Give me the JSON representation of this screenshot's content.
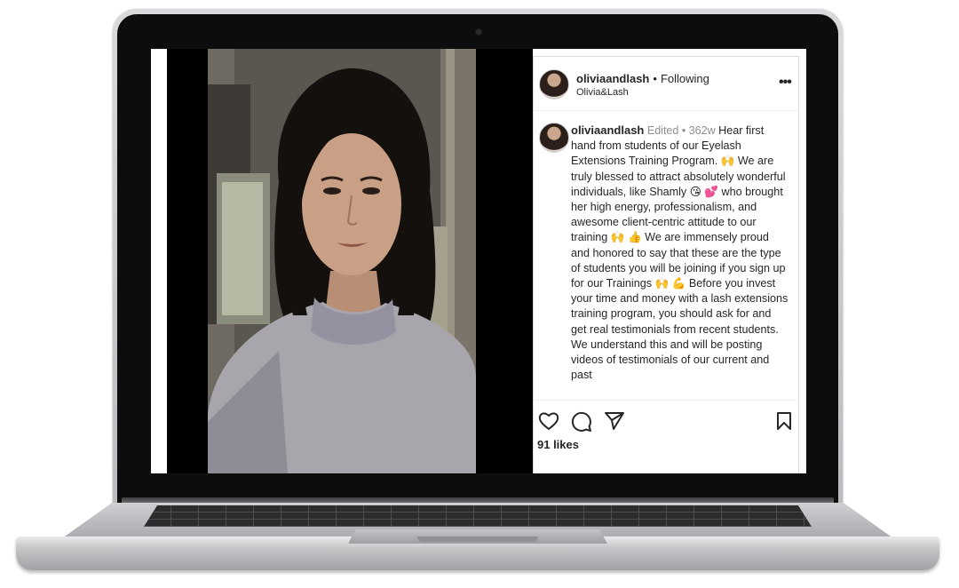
{
  "post": {
    "username": "oliviaandlash",
    "separator": "•",
    "follow_status": "Following",
    "subtitle": "Olivia&Lash",
    "more_label": "•••",
    "caption_username": "oliviaandlash",
    "edited_label": "Edited",
    "age": "362w",
    "caption_text": "Hear first hand from students of our Eyelash Extensions Training Program. 🙌 We are truly blessed to attract absolutely wonderful individuals, like Shamly 😘 💕 who brought her high energy, professionalism, and awesome client-centric attitude to our training 🙌 👍 We are immensely proud and honored to say that these are the type of students you will be joining if you sign up for our Trainings 🙌 💪 Before you invest your time and money with a lash extensions training program, you should ask for and get real testimonials from recent students. We understand this and will be posting videos of testimonials of our current and past",
    "likes": "91 likes"
  },
  "icons": {
    "like": "heart-icon",
    "comment": "comment-icon",
    "share": "paper-plane-icon",
    "save": "bookmark-icon"
  },
  "colors": {
    "text": "#262626",
    "muted": "#8e8e8e",
    "border": "#dbdbdb"
  }
}
